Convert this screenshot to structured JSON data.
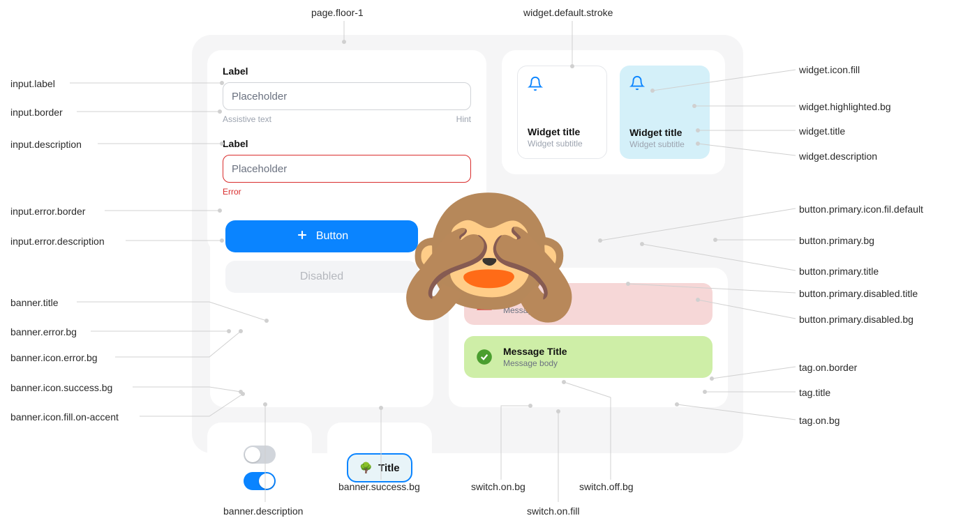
{
  "callouts": {
    "page_floor": "page.floor-1",
    "widget_default_stroke": "widget.default.stroke",
    "input_label": "input.label",
    "input_border": "input.border",
    "input_description": "input.description",
    "input_error_border": "input.error.border",
    "input_error_description": "input.error.description",
    "banner_title": "banner.title",
    "banner_error_bg": "banner.error.bg",
    "banner_icon_error_bg": "banner.icon.error.bg",
    "banner_icon_success_bg": "banner.icon.success.bg",
    "banner_icon_fill_on_accent": "banner.icon.fill.on-accent",
    "banner_description": "banner.description",
    "banner_success_bg": "banner.success.bg",
    "switch_on_bg": "switch.on.bg",
    "switch_on_fill": "switch.on.fill",
    "switch_off_bg": "switch.off.bg",
    "widget_icon_fill": "widget.icon.fill",
    "widget_highlighted_bg": "widget.highlighted.bg",
    "widget_title": "widget.title",
    "widget_description": "widget.description",
    "button_primary_icon_fill_default": "button.primary.icon.fil.default",
    "button_primary_bg": "button.primary.bg",
    "button_primary_title": "button.primary.title",
    "button_primary_disabled_title": "button.primary.disabled.title",
    "button_primary_disabled_bg": "button.primary.disabled.bg",
    "tag_on_border": "tag.on.border",
    "tag_title": "tag.title",
    "tag_on_bg": "tag.on.bg"
  },
  "inputs": {
    "default": {
      "label": "Label",
      "placeholder": "Placeholder",
      "assistive": "Assistive text",
      "hint": "Hint"
    },
    "error": {
      "label": "Label",
      "placeholder": "Placeholder",
      "message": "Error"
    }
  },
  "widgets": {
    "default": {
      "title": "Widget title",
      "subtitle": "Widget subtitle",
      "icon": "bell-icon"
    },
    "highlighted": {
      "title": "Widget title",
      "subtitle": "Widget subtitle",
      "icon": "bell-icon"
    }
  },
  "buttons": {
    "primary": {
      "label": "Button",
      "icon": "plus-icon"
    },
    "disabled": {
      "label": "Disabled"
    }
  },
  "banners": {
    "error": {
      "title": "Message Title",
      "body": "Message body"
    },
    "success": {
      "title": "Message Title",
      "body": "Message body"
    }
  },
  "tag": {
    "label": "Title",
    "emoji": "🌳"
  },
  "emoji": "🙈"
}
